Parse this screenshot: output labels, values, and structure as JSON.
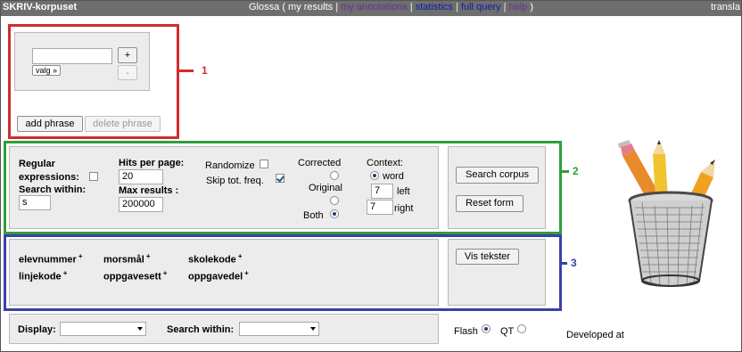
{
  "header": {
    "brand": "SKRIV-korpuset",
    "nav": [
      {
        "label": "Glossa",
        "color": "#ffffff"
      },
      {
        "label": "my results",
        "color": "#ffffff"
      },
      {
        "label": "my annotations",
        "color": "#663399"
      },
      {
        "label": "statistics",
        "color": "#0b1fa6"
      },
      {
        "label": "full query",
        "color": "#0b1fa6"
      },
      {
        "label": "help",
        "color": "#663399"
      }
    ],
    "nav_open": "(",
    "nav_sep": "|",
    "nav_close": ")",
    "right_label": "transla"
  },
  "phrase_box": {
    "word_value": "",
    "plus_label": "+",
    "minus_label": "-",
    "valg_label": "valg »",
    "add_phrase_label": "add phrase",
    "delete_phrase_label": "delete phrase"
  },
  "options": {
    "regular_expressions_label": "Regular expressions:",
    "search_within_label": "Search within:",
    "search_within_value": "s",
    "hits_per_page_label": "Hits per page:",
    "hits_per_page_value": "20",
    "max_results_label": "Max results :",
    "max_results_value": "200000",
    "randomize_label": "Randomize",
    "skip_tot_freq_label": "Skip tot. freq.",
    "randomize_checked": false,
    "skip_tot_freq_checked": true,
    "corrected_label": "Corrected",
    "original_label": "Original",
    "both_label": "Both",
    "version_selected": "Both",
    "context_label": "Context:",
    "word_label": "word",
    "context_left_value": "7",
    "left_label": "left",
    "context_right_value": "7",
    "right_label": "right",
    "search_corpus_label": "Search corpus",
    "reset_form_label": "Reset form"
  },
  "metadata": {
    "fields": [
      "elevnummer",
      "morsmål",
      "skolekode",
      "linjekode",
      "oppgavesett",
      "oppgavedel"
    ],
    "plus_symbol": "+",
    "vis_tekster_label": "Vis tekster"
  },
  "bottom": {
    "display_label": "Display:",
    "display_value": "",
    "search_within_label": "Search within:",
    "search_within_value": "",
    "flash_label": "Flash",
    "qt_label": "QT",
    "player_selected": "Flash",
    "developed_at_label": "Developed at"
  },
  "annotations": [
    {
      "label": "1",
      "color": "#d22d2d"
    },
    {
      "label": "2",
      "color": "#2f9e3a"
    },
    {
      "label": "3",
      "color": "#3842a8"
    }
  ]
}
